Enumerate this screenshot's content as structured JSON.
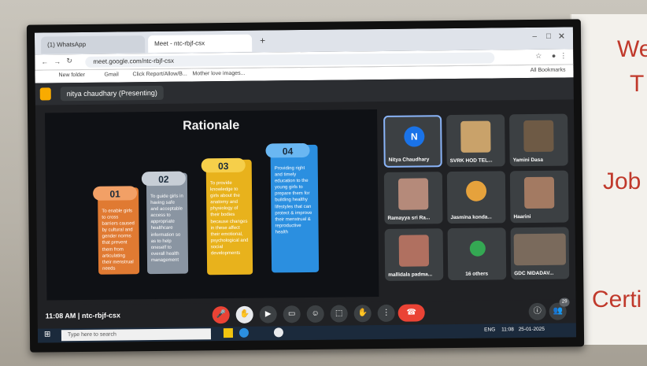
{
  "poster": {
    "line1": "We",
    "line2": "T",
    "line3": "Job",
    "line4": "Certi"
  },
  "browser": {
    "tabs": [
      {
        "label": "(1) WhatsApp"
      },
      {
        "label": "Meet - ntc-rbjf-csx"
      }
    ],
    "url": "meet.google.com/ntc-rbjf-csx",
    "bookmarks": [
      "New folder",
      "Gmail",
      "Click Report/Allow/B...",
      "Mother love images..."
    ],
    "all_bookmarks": "All Bookmarks"
  },
  "meet": {
    "presenting_label": "nitya chaudhary (Presenting)",
    "meeting_time": "11:08 AM",
    "meeting_code": "ntc-rbjf-csx",
    "participant_count": "29"
  },
  "slide": {
    "title": "Rationale",
    "items": [
      {
        "num": "01",
        "text": "To enable girls to cross barriers caused by cultural and gender norms that prevent them from articulating their menstrual needs",
        "color": "#e07a32",
        "num_color": "#f2a066"
      },
      {
        "num": "02",
        "text": "To guide girls in having safe and acceptable access to appropriate healthcare information so as to help oneself to overall health management",
        "color": "#8a95a2",
        "num_color": "#c7ced6"
      },
      {
        "num": "03",
        "text": "To provide knowledge to girls about the anatomy and physiology of their bodies because changes in these affect their emotional, psychological and social developments",
        "color": "#e8b21c",
        "num_color": "#f6cf4a"
      },
      {
        "num": "04",
        "text": "Providing right and timely education to the young girls to prepare them for building healthy lifestyles that can protect & improve their menstrual & reproductive health",
        "color": "#2b8fe0",
        "num_color": "#6ab7f2"
      }
    ]
  },
  "participants": [
    {
      "name": "Nitya Chaudhary",
      "initial": "N"
    },
    {
      "name": "SVRK HOD TEL..."
    },
    {
      "name": "Yamini Dasa"
    },
    {
      "name": "Ramayya sri Ra..."
    },
    {
      "name": "Jasmina konda..."
    },
    {
      "name": "Haarini"
    },
    {
      "name": "mallidala padma..."
    },
    {
      "name": "16 others"
    },
    {
      "name": "GDC NIDADAV..."
    }
  ],
  "taskbar": {
    "search_placeholder": "Type here to search",
    "lang": "ENG",
    "clock_time": "11:08",
    "clock_date": "25-01-2025"
  }
}
